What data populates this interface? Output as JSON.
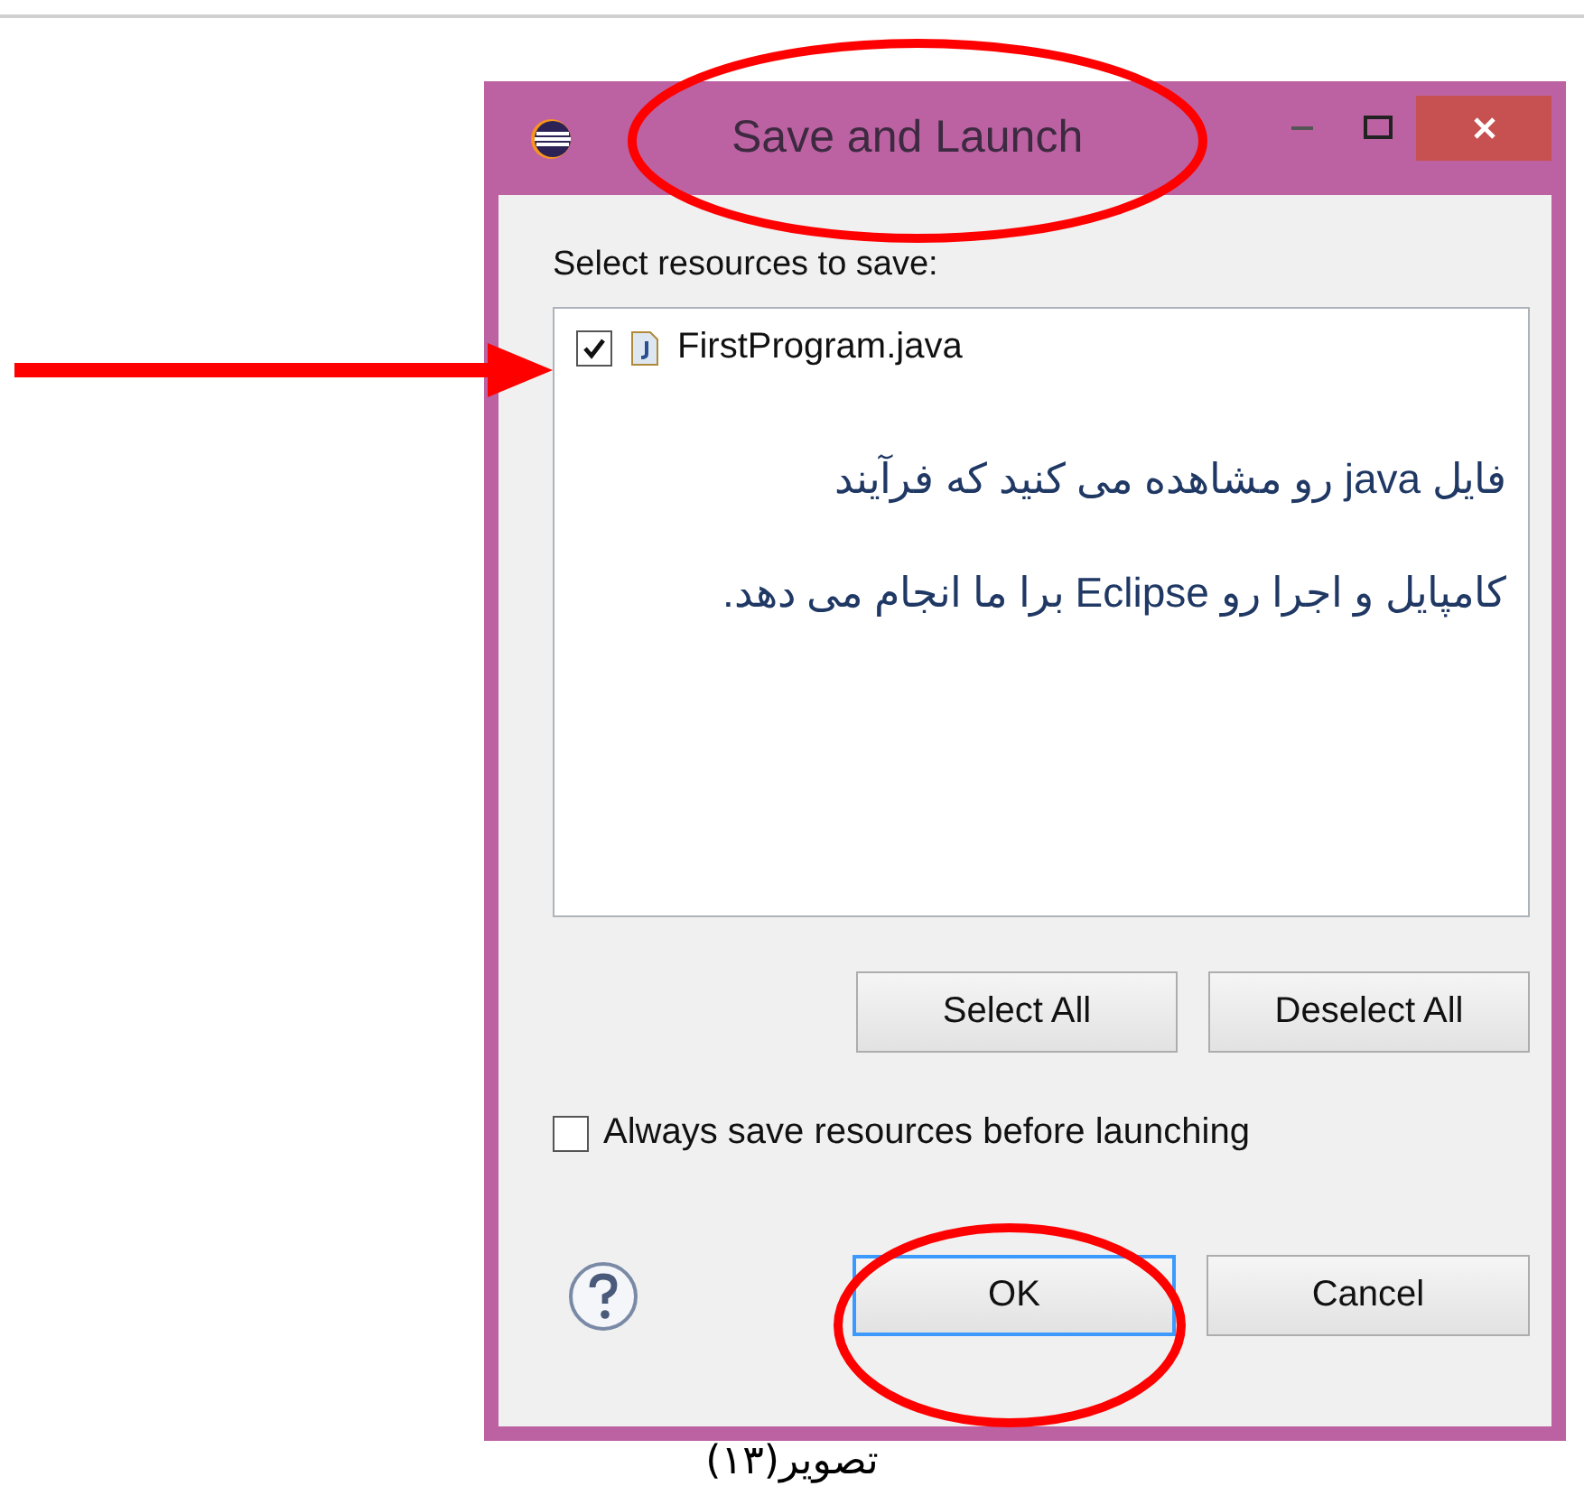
{
  "dialog": {
    "title": "Save and Launch",
    "prompt": "Select resources to save:",
    "resources": [
      {
        "name": "FirstProgram.java",
        "checked": true
      }
    ],
    "annotation_lines": [
      "فایل java  رو مشاهده می کنید که فرآیند",
      "کامپایل و اجرا رو  Eclipse برا ما انجام می دهد."
    ],
    "buttons": [
      {
        "label": "Select All"
      },
      {
        "label": "Deselect All"
      }
    ],
    "always_save": {
      "label": "Always save resources before launching",
      "checked": false
    },
    "footer_buttons": [
      {
        "label": "OK",
        "focused": true
      },
      {
        "label": "Cancel",
        "focused": false
      }
    ]
  },
  "caption": "تصویر(۱۳)"
}
